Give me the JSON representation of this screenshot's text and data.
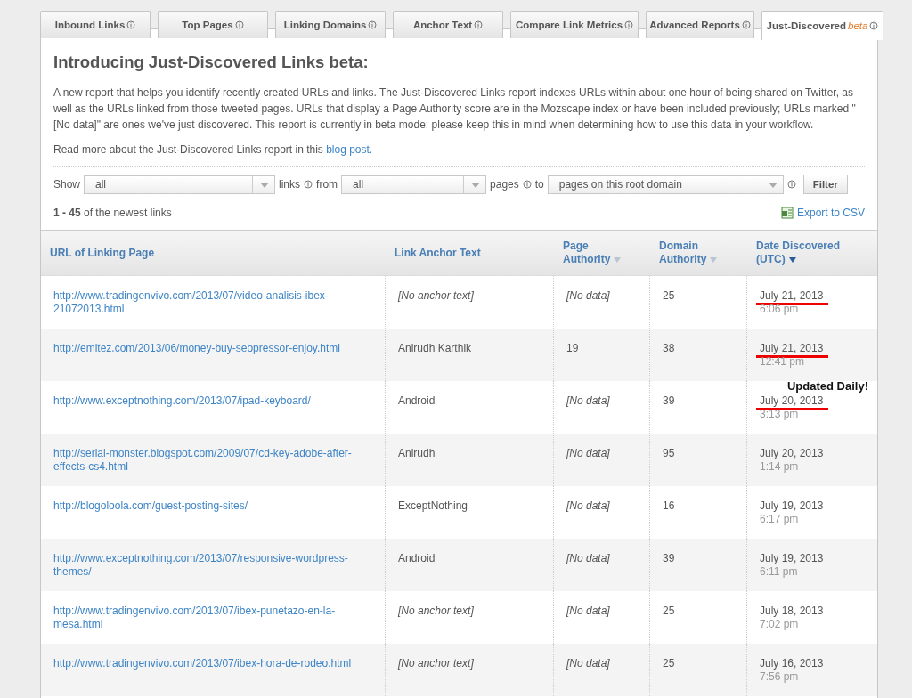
{
  "tabs": [
    {
      "label": "Inbound Links",
      "selected": false
    },
    {
      "label": "Top Pages",
      "selected": false
    },
    {
      "label": "Linking Domains",
      "selected": false
    },
    {
      "label": "Anchor Text",
      "selected": false
    },
    {
      "label": "Compare Link Metrics",
      "selected": false
    },
    {
      "label": "Advanced Reports",
      "selected": false
    },
    {
      "label": "Just-Discovered",
      "badge": "beta",
      "selected": true
    }
  ],
  "title": "Introducing Just-Discovered Links beta:",
  "description": "A new report that helps you identify recently created URLs and links. The Just-Discovered Links report indexes URLs within about one hour of being shared on Twitter, as well as the URLs linked from those tweeted pages. URLs that display a Page Authority score are in the Mozscape index or have been included previously; URLs marked \"[No data]\" are ones we've just discovered. This report is currently in beta mode; please keep this in mind when determining how to use this data in your workflow.",
  "read_more": {
    "text": "Read more about the Just-Discovered Links report in this",
    "link": "blog post."
  },
  "filters": {
    "show_label": "Show",
    "show_value": "all",
    "links_label": "links",
    "from_label": "from",
    "from_value": "all",
    "pages_label": "pages",
    "to_label": "to",
    "to_value": "pages on this root domain",
    "button": "Filter"
  },
  "count": {
    "range": "1 - 45",
    "text": "of the newest links"
  },
  "export": "Export to CSV",
  "table": {
    "columns": [
      {
        "label": "URL of Linking Page"
      },
      {
        "label": "Link Anchor Text"
      },
      {
        "label": "Page Authority",
        "sorted": false
      },
      {
        "label": "Domain Authority",
        "sorted": false
      },
      {
        "label": "Date Discovered (UTC)",
        "sorted": true
      }
    ],
    "rows": [
      {
        "url": "http://www.tradingenvivo.com/2013/07/video-analisis-ibex-21072013.html",
        "anchor": "[No anchor text]",
        "anchor_missing": true,
        "pa": "[No data]",
        "pa_missing": true,
        "da": "25",
        "date": "July 21, 2013",
        "time": "6:06 pm",
        "underlined": true
      },
      {
        "url": "http://emitez.com/2013/06/money-buy-seopressor-enjoy.html",
        "anchor": "Anirudh Karthik",
        "anchor_missing": false,
        "pa": "19",
        "pa_missing": false,
        "da": "38",
        "date": "July 21, 2013",
        "time": "12:41 pm",
        "underlined": true
      },
      {
        "url": "http://www.exceptnothing.com/2013/07/ipad-keyboard/",
        "anchor": "Android",
        "anchor_missing": false,
        "pa": "[No data]",
        "pa_missing": true,
        "da": "39",
        "date": "July 20, 2013",
        "time": "3:13 pm",
        "underlined": true
      },
      {
        "url": "http://serial-monster.blogspot.com/2009/07/cd-key-adobe-after-effects-cs4.html",
        "anchor": "Anirudh",
        "anchor_missing": false,
        "pa": "[No data]",
        "pa_missing": true,
        "da": "95",
        "date": "July 20, 2013",
        "time": "1:14 pm",
        "underlined": false
      },
      {
        "url": "http://blogoloola.com/guest-posting-sites/",
        "anchor": "ExceptNothing",
        "anchor_missing": false,
        "pa": "[No data]",
        "pa_missing": true,
        "da": "16",
        "date": "July 19, 2013",
        "time": "6:17 pm",
        "underlined": false
      },
      {
        "url": "http://www.exceptnothing.com/2013/07/responsive-wordpress-themes/",
        "anchor": "Android",
        "anchor_missing": false,
        "pa": "[No data]",
        "pa_missing": true,
        "da": "39",
        "date": "July 19, 2013",
        "time": "6:11 pm",
        "underlined": false
      },
      {
        "url": "http://www.tradingenvivo.com/2013/07/ibex-punetazo-en-la-mesa.html",
        "anchor": "[No anchor text]",
        "anchor_missing": true,
        "pa": "[No data]",
        "pa_missing": true,
        "da": "25",
        "date": "July 18, 2013",
        "time": "7:02 pm",
        "underlined": false
      },
      {
        "url": "http://www.tradingenvivo.com/2013/07/ibex-hora-de-rodeo.html",
        "anchor": "[No anchor text]",
        "anchor_missing": true,
        "pa": "[No data]",
        "pa_missing": true,
        "da": "25",
        "date": "July 16, 2013",
        "time": "7:56 pm",
        "underlined": false
      }
    ]
  },
  "annotation": "Updated Daily!"
}
